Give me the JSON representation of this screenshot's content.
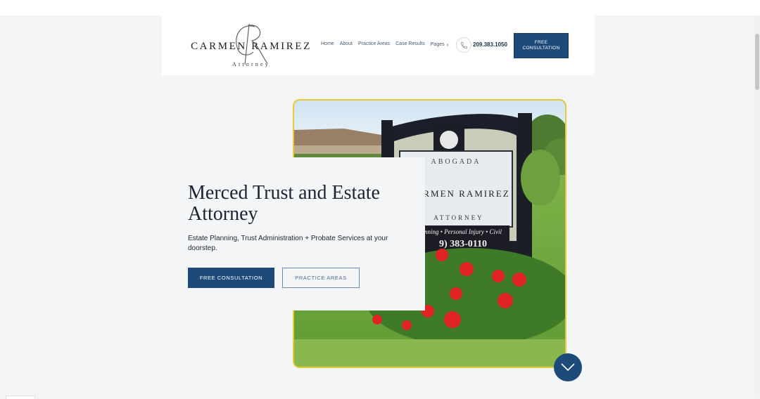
{
  "header": {
    "logo": {
      "monogram": "CR",
      "name": "CARMEN RAMIREZ",
      "subtitle": "Attorney"
    },
    "nav": [
      {
        "label": "Home"
      },
      {
        "label": "About"
      },
      {
        "label": "Practice Areas"
      },
      {
        "label": "Case Results"
      },
      {
        "label": "Pages"
      }
    ],
    "phone": "209.383.1050",
    "cta_label": "FREE CONSULTATION"
  },
  "hero": {
    "title": "Merced Trust and Estate Attorney",
    "subtitle": "Estate Planning, Trust Administration + Probate Services at your doorstep.",
    "primary_button": "FREE CONSULTATION",
    "secondary_button": "PRACTICE AREAS"
  },
  "sign_photo": {
    "top_word": "ABOGADA",
    "name": "CARMEN RAMIREZ",
    "title": "ATTORNEY",
    "services": "nning • Personal Injury • Civil",
    "phone": "9) 383-0110"
  },
  "colors": {
    "brand_blue": "#1e4a7a",
    "image_border": "#e8c936",
    "background": "#f4f5f7"
  }
}
